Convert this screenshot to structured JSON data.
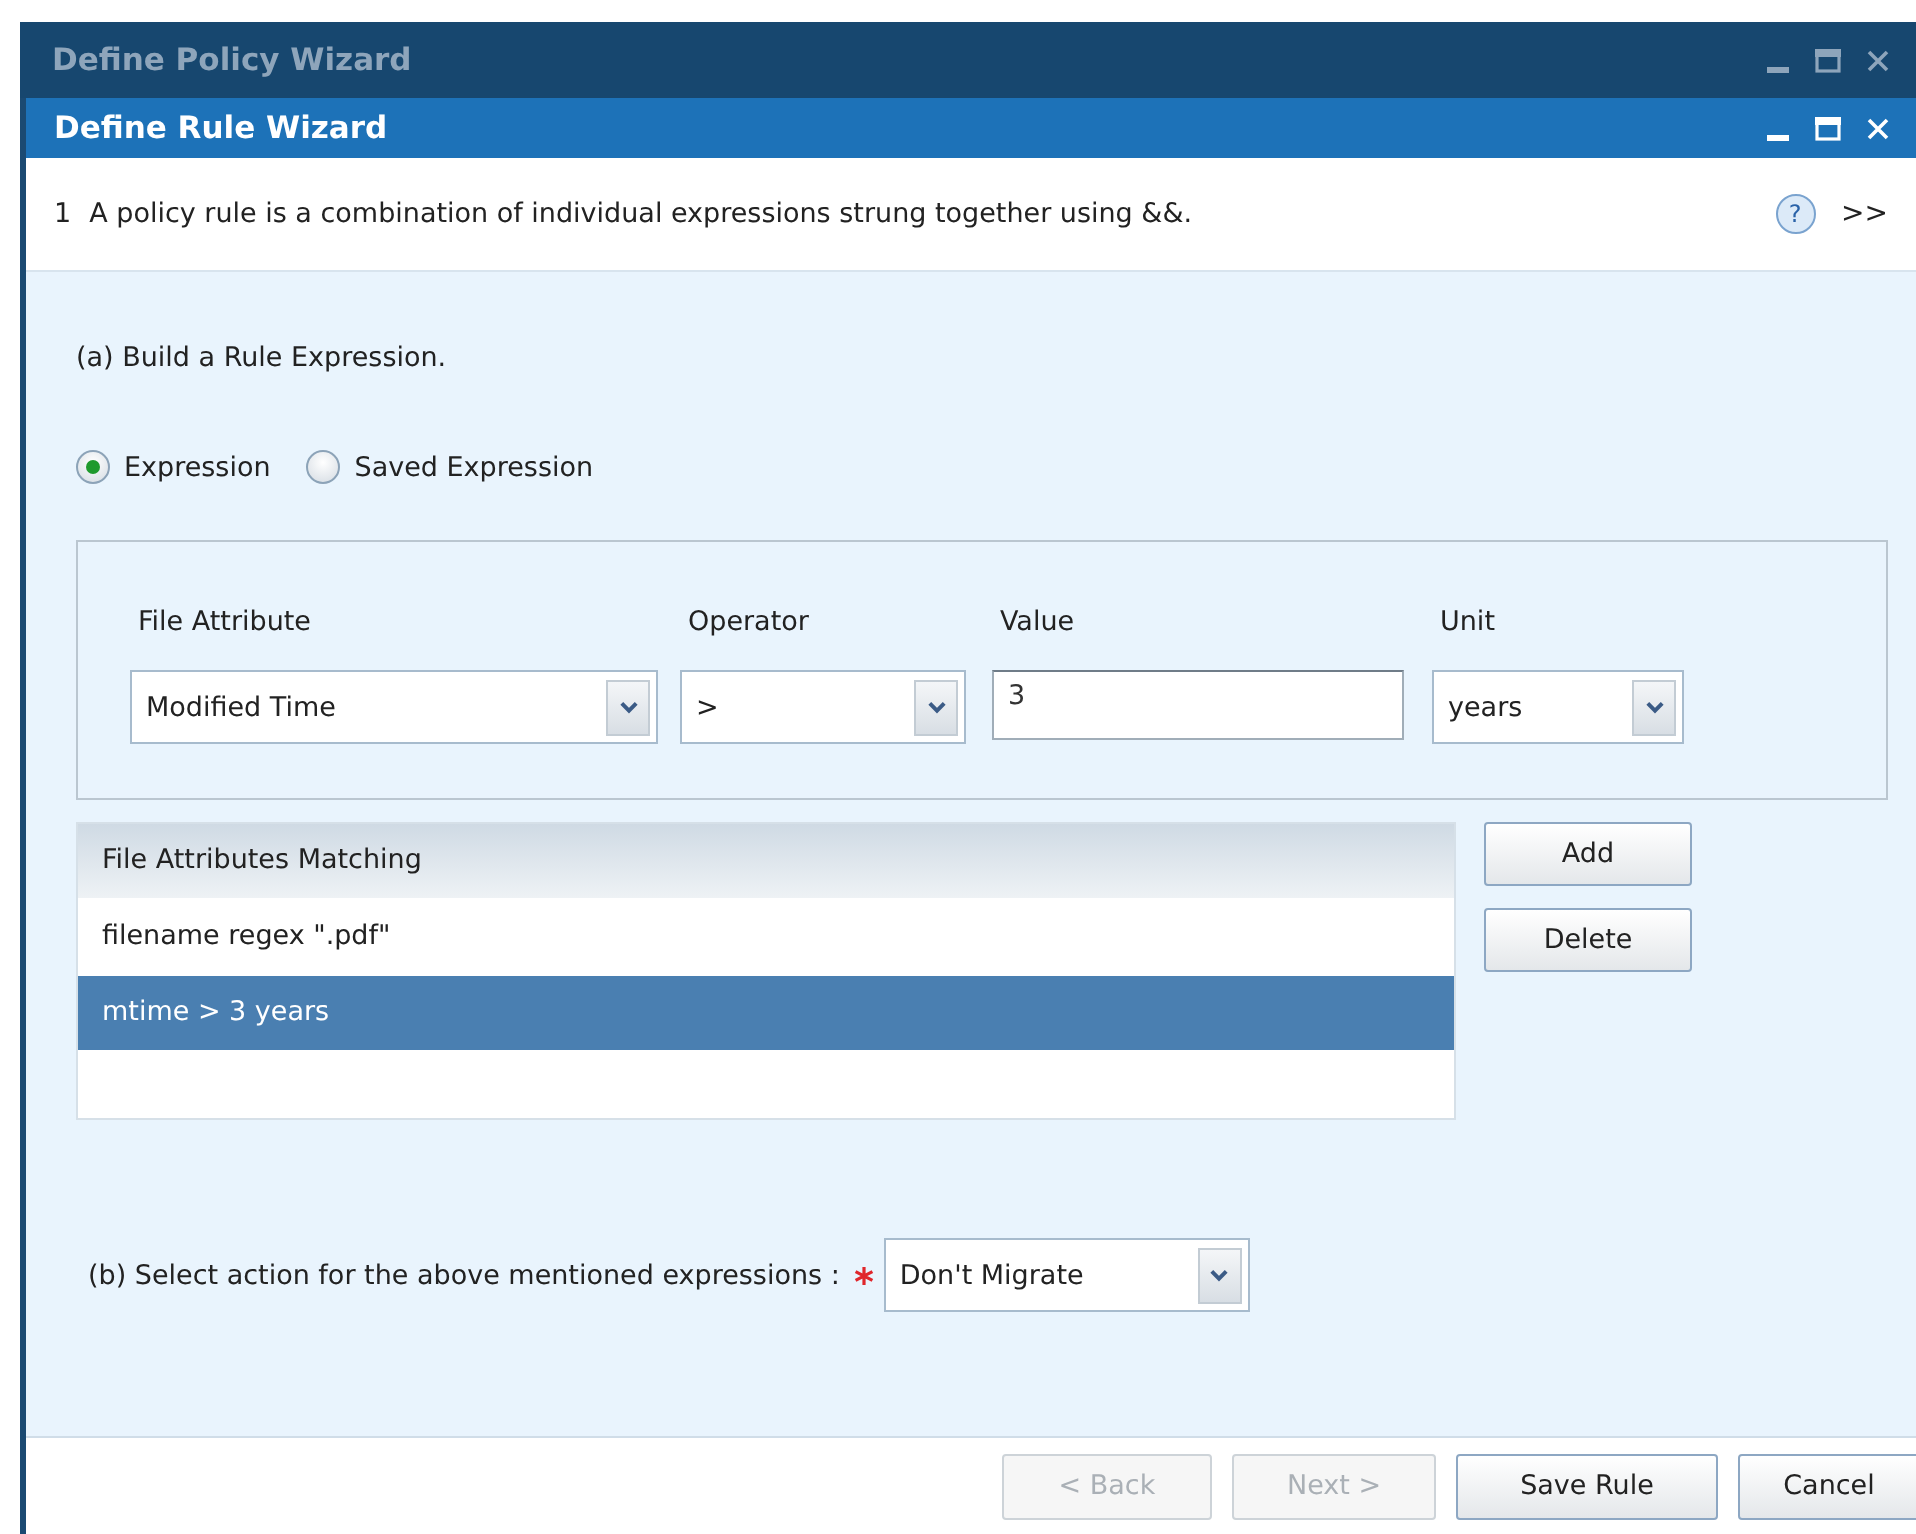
{
  "outer_window": {
    "title": "Define Policy Wizard",
    "active": false
  },
  "window": {
    "title": "Define Rule Wizard",
    "active": true
  },
  "step": {
    "number": "1",
    "text": "A policy rule is a combination of individual expressions strung together using &&.",
    "help": "?",
    "next": ">>"
  },
  "section_a": {
    "heading": "(a) Build a Rule Expression.",
    "radios": [
      {
        "label": "Expression",
        "selected": true
      },
      {
        "label": "Saved Expression",
        "selected": false
      }
    ],
    "fields": [
      {
        "kind": "select",
        "label": "File Attribute",
        "value": "Modified Time"
      },
      {
        "kind": "select",
        "label": "Operator",
        "value": ">"
      },
      {
        "kind": "text",
        "label": "Value",
        "value": "3"
      },
      {
        "kind": "select",
        "label": "Unit",
        "value": "years"
      }
    ],
    "table": {
      "columns": [
        "File Attributes Matching"
      ],
      "rows": [
        {
          "text": "filename regex \".pdf\"",
          "selected": false
        },
        {
          "text": "mtime > 3 years",
          "selected": true
        }
      ]
    },
    "buttons": [
      "Add",
      "Delete"
    ]
  },
  "section_b": {
    "label": "(b) Select action for the above mentioned expressions :",
    "required": true,
    "value": "Don't Migrate"
  },
  "footer_buttons": [
    {
      "label": "< Back",
      "disabled": true
    },
    {
      "label": "Next >",
      "disabled": true
    },
    {
      "label": "Save Rule",
      "disabled": false
    },
    {
      "label": "Cancel",
      "disabled": false
    }
  ]
}
